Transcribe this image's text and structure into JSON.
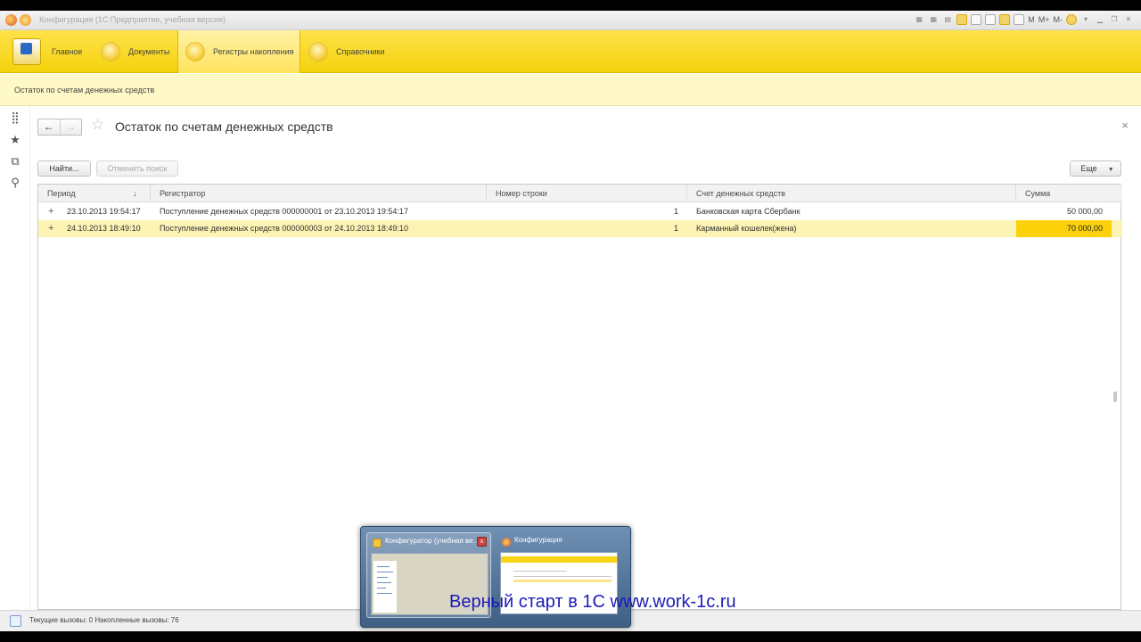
{
  "window": {
    "title": "Конфигурация  (1С:Предприятие, учебная версия)",
    "toolbar_labels": {
      "m": "M",
      "m_plus": "M+",
      "m_minus": "M-"
    }
  },
  "sections": [
    {
      "label": "Главное"
    },
    {
      "label": "Документы"
    },
    {
      "label": "Регистры накопления"
    },
    {
      "label": "Справочники"
    }
  ],
  "nav": {
    "current_link": "Остаток по счетам денежных средств"
  },
  "form": {
    "title": "Остаток по счетам денежных средств",
    "back_icon": "←",
    "forward_icon": "→",
    "find_button": "Найти...",
    "cancel_search_button": "Отменить поиск",
    "more_button": "Еще",
    "close_icon": "×"
  },
  "table": {
    "columns": [
      "Период",
      "Регистратор",
      "Номер строки",
      "Счет денежных средств",
      "Сумма"
    ],
    "sort_icon": "↓",
    "rows": [
      {
        "period": "23.10.2013 19:54:17",
        "registrar": "Поступление денежных средств 000000001 от 23.10.2013 19:54:17",
        "line": "1",
        "account": "Банковская карта Сбербанк",
        "sum": "50 000,00"
      },
      {
        "period": "24.10.2013 18:49:10",
        "registrar": "Поступление денежных средств 000000003 от 24.10.2013 18:49:10",
        "line": "1",
        "account": "Карманный кошелек(жена)",
        "sum": "70 000,00"
      }
    ]
  },
  "status": {
    "text": "Текущие вызовы: 0   Накопленные вызовы: 76"
  },
  "switcher": {
    "items": [
      {
        "title": "Конфигуратор (учебная ве..."
      },
      {
        "title": "Конфигурация"
      }
    ],
    "close_icon": "x"
  },
  "watermark": {
    "text": "Верный старт в 1С www.work-1c.ru"
  },
  "colors": {
    "section_bar": "#f4d20c",
    "selected_row": "#fdf3b4",
    "selected_cell": "#fbd20a",
    "watermark": "#1b1bb8"
  }
}
